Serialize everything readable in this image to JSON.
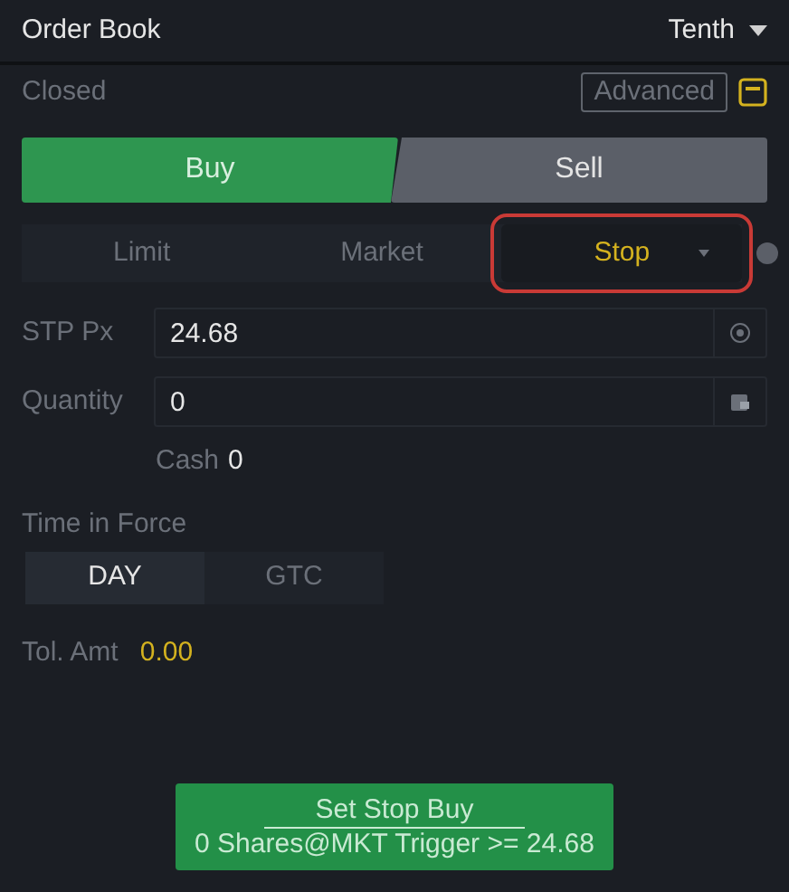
{
  "header": {
    "title": "Order Book",
    "level_select": "Tenth"
  },
  "status": "Closed",
  "advanced": {
    "label": "Advanced",
    "on": false
  },
  "sides": [
    {
      "label": "Buy",
      "selected": true
    },
    {
      "label": "Sell",
      "selected": false
    }
  ],
  "order_types": [
    {
      "label": "Limit",
      "selected": false,
      "dropdown": false
    },
    {
      "label": "Market",
      "selected": false,
      "dropdown": false
    },
    {
      "label": "Stop",
      "selected": true,
      "dropdown": true
    }
  ],
  "stop_price": {
    "label": "STP Px",
    "value": "24.68"
  },
  "quantity": {
    "label": "Quantity",
    "value": "0"
  },
  "cash": {
    "label": "Cash",
    "value": "0"
  },
  "time_in_force": {
    "label": "Time in Force",
    "options": [
      {
        "label": "DAY",
        "selected": true
      },
      {
        "label": "GTC",
        "selected": false
      }
    ]
  },
  "tol_amt": {
    "label": "Tol. Amt",
    "value": "0.00"
  },
  "submit": {
    "title": "Set Stop Buy",
    "detail": "0 Shares@MKT Trigger >= 24.68"
  }
}
